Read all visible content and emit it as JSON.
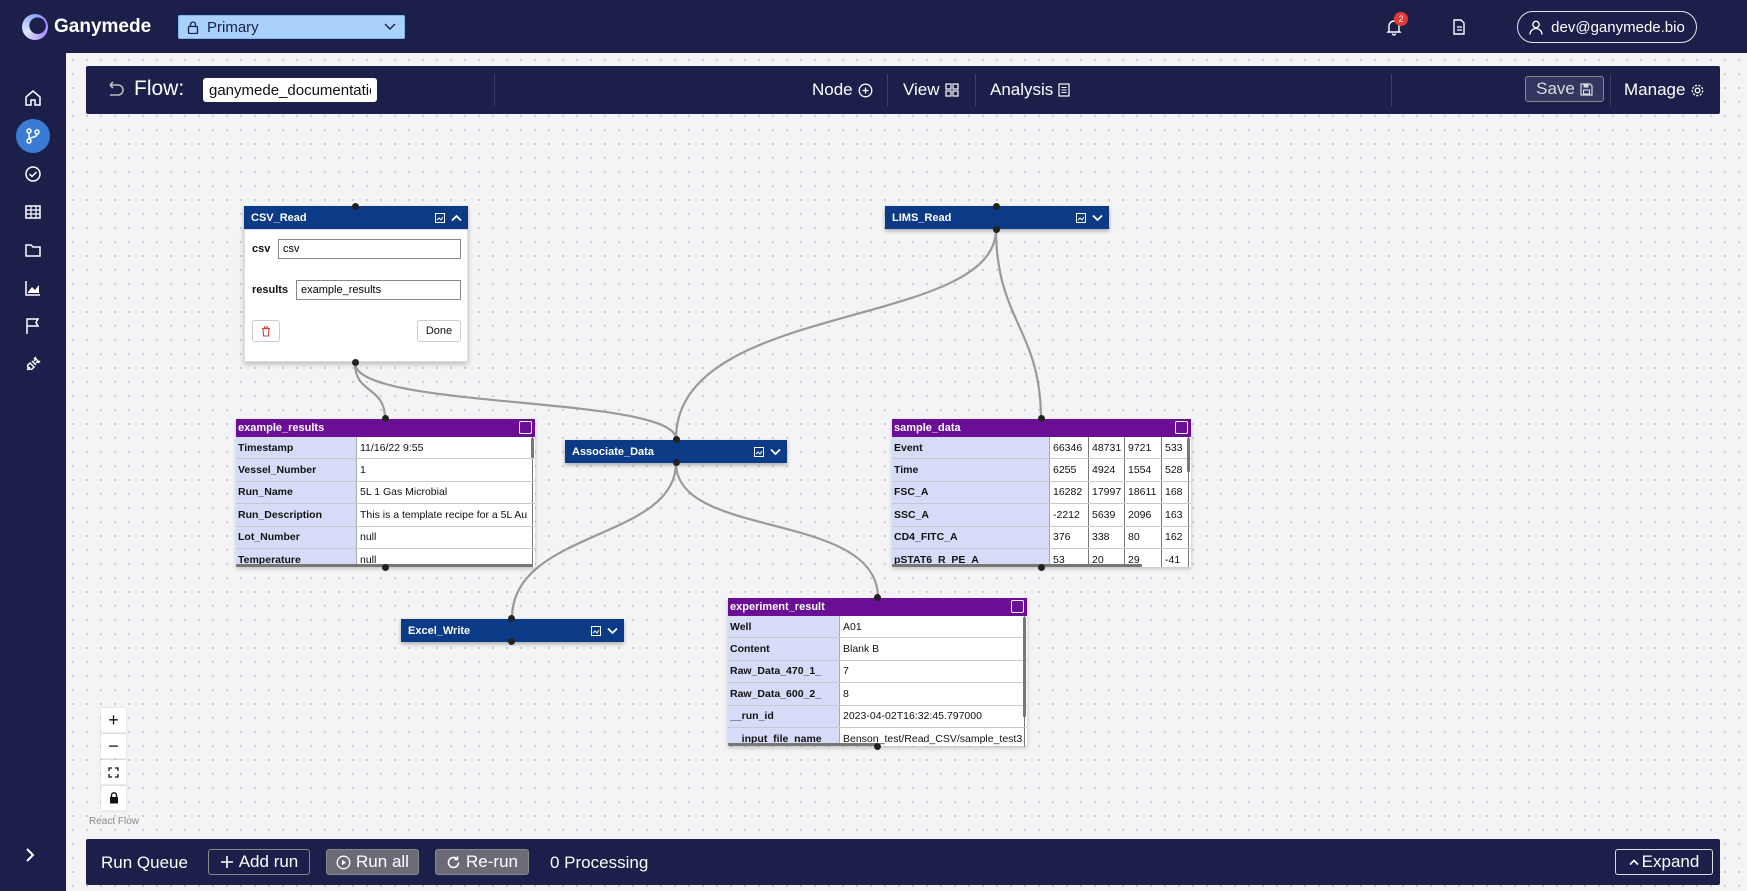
{
  "app": {
    "name": "Ganymede"
  },
  "workspace": {
    "label": "Primary"
  },
  "notifications": {
    "count": "2"
  },
  "user": {
    "email": "dev@ganymede.bio"
  },
  "flowbar": {
    "title": "Flow:",
    "flow_name": "ganymede_documentation",
    "menus": {
      "node": "Node",
      "view": "View",
      "analysis": "Analysis"
    },
    "save": "Save",
    "manage": "Manage"
  },
  "nodes": {
    "csv_read": {
      "title": "CSV_Read",
      "params": [
        {
          "label": "csv",
          "value": "csv"
        },
        {
          "label": "results",
          "value": "example_results"
        }
      ],
      "done": "Done"
    },
    "lims_read": {
      "title": "LIMS_Read"
    },
    "associate_data": {
      "title": "Associate_Data"
    },
    "excel_write": {
      "title": "Excel_Write"
    }
  },
  "tables": {
    "example_results": {
      "title": "example_results",
      "rows": [
        {
          "k": "Timestamp",
          "v": "11/16/22 9:55"
        },
        {
          "k": "Vessel_Number",
          "v": "1"
        },
        {
          "k": "Run_Name",
          "v": "5L 1 Gas Microbial"
        },
        {
          "k": "Run_Description",
          "v": "This is a template recipe for a 5L Au"
        },
        {
          "k": "Lot_Number",
          "v": "null"
        },
        {
          "k": "Temperature",
          "v": "null"
        }
      ]
    },
    "sample_data": {
      "title": "sample_data",
      "rows": [
        {
          "k": "Event",
          "v": [
            "66346",
            "48731",
            "9721",
            "533"
          ]
        },
        {
          "k": "Time",
          "v": [
            "6255",
            "4924",
            "1554",
            "528"
          ]
        },
        {
          "k": "FSC_A",
          "v": [
            "16282",
            "17997",
            "18611",
            "168"
          ]
        },
        {
          "k": "SSC_A",
          "v": [
            "-2212",
            "5639",
            "2096",
            "163"
          ]
        },
        {
          "k": "CD4_FITC_A",
          "v": [
            "376",
            "338",
            "80",
            "162"
          ]
        },
        {
          "k": "pSTAT6_R_PE_A",
          "v": [
            "53",
            "20",
            "29",
            "-41"
          ]
        }
      ]
    },
    "experiment_result": {
      "title": "experiment_result",
      "rows": [
        {
          "k": "Well",
          "v": "A01"
        },
        {
          "k": "Content",
          "v": "Blank B"
        },
        {
          "k": "Raw_Data_470_1_",
          "v": "7"
        },
        {
          "k": "Raw_Data_600_2_",
          "v": "8"
        },
        {
          "k": "__run_id",
          "v": "2023-04-02T16:32:45.797000"
        },
        {
          "k": "__input_file_name",
          "v": "Benson_test/Read_CSV/sample_test3"
        }
      ]
    }
  },
  "zoom_controls": {
    "zoom_in": "+",
    "zoom_out": "−"
  },
  "react_flow_attribution": "React Flow",
  "run_queue": {
    "label": "Run Queue",
    "add_run": "Add run",
    "run_all": "Run all",
    "rerun": "Re-run",
    "processing": "0 Processing",
    "expand": "Expand"
  }
}
